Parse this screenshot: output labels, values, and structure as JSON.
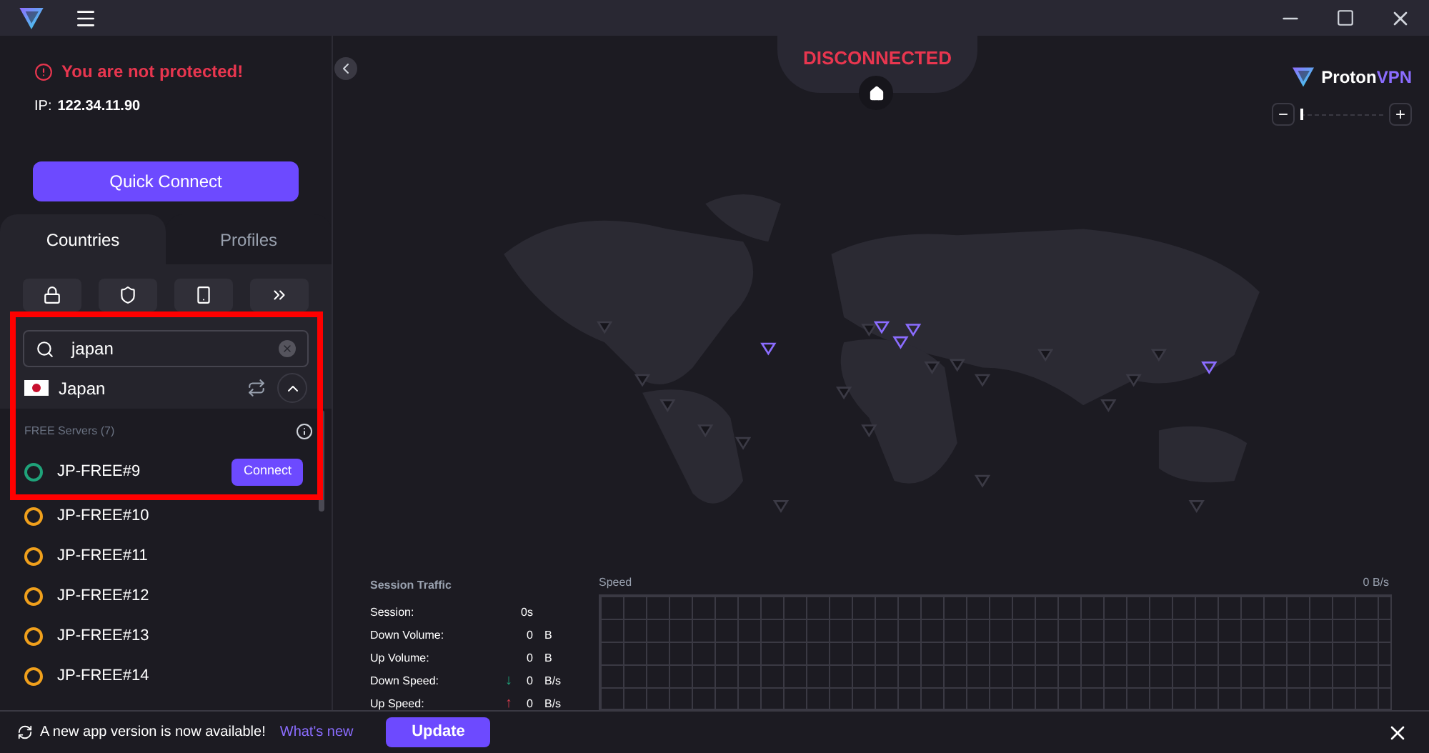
{
  "status": {
    "warning": "You are not protected!",
    "ip_label": "IP:",
    "ip": "122.34.11.90",
    "connection": "DISCONNECTED"
  },
  "quick_connect": "Quick Connect",
  "tabs": [
    {
      "label": "Countries",
      "selected": true
    },
    {
      "label": "Profiles",
      "selected": false
    }
  ],
  "search": {
    "value": "japan"
  },
  "country": {
    "name": "Japan",
    "expanded": true
  },
  "group": {
    "label": "FREE Servers (7)"
  },
  "servers": [
    {
      "name": "JP-FREE#9",
      "color": "#1fa37a",
      "connect": "Connect"
    },
    {
      "name": "JP-FREE#10",
      "color": "#f0a01c"
    },
    {
      "name": "JP-FREE#11",
      "color": "#f0a01c"
    },
    {
      "name": "JP-FREE#12",
      "color": "#f0a01c"
    },
    {
      "name": "JP-FREE#13",
      "color": "#f0a01c"
    },
    {
      "name": "JP-FREE#14",
      "color": "#f0a01c"
    }
  ],
  "logo": {
    "brand": "Proton",
    "product": "VPN"
  },
  "zoom": {
    "level": 0,
    "minus": "−",
    "plus": "+"
  },
  "traffic": {
    "title": "Session Traffic",
    "rows": [
      {
        "label": "Session:",
        "value": "0s"
      },
      {
        "label": "Down Volume:",
        "value": "0",
        "unit": "B"
      },
      {
        "label": "Up Volume:",
        "value": "0",
        "unit": "B"
      },
      {
        "label": "Down Speed:",
        "kind": "down",
        "arrow": "↓",
        "value": "0",
        "unit": "B/s"
      },
      {
        "label": "Up Speed:",
        "kind": "up",
        "arrow": "↑",
        "value": "0",
        "unit": "B/s"
      }
    ],
    "chart_label": "Speed",
    "chart_reading": "0 B/s"
  },
  "banner": {
    "message": "A new app version is now available!",
    "link": "What's new",
    "button": "Update"
  }
}
